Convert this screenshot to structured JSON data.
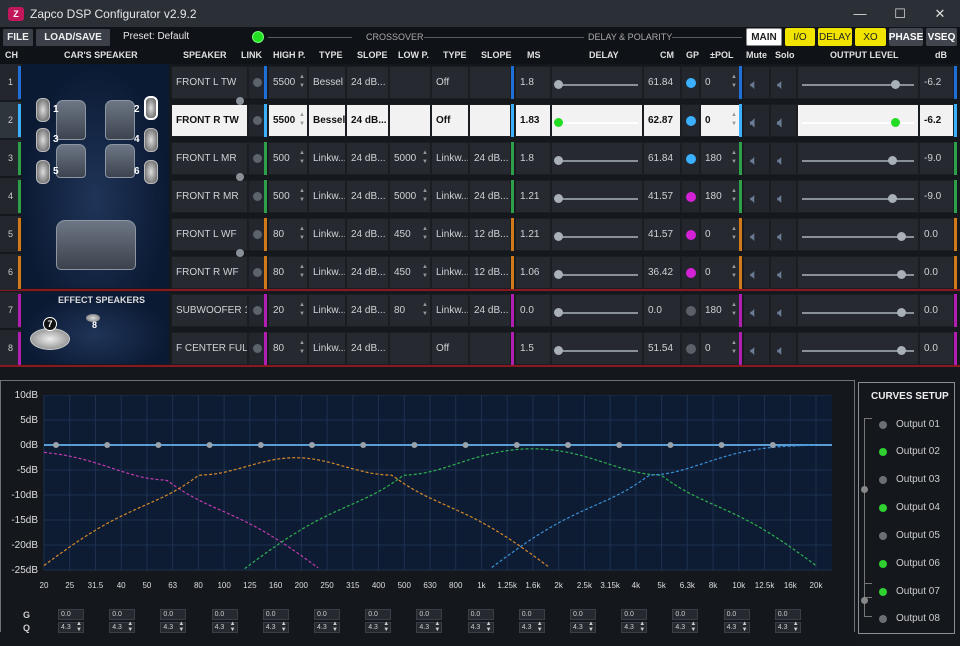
{
  "window": {
    "title": "Zapco DSP Configurator v2.9.2",
    "minimize": "—",
    "maximize": "☐",
    "close": "✕",
    "logo": "Z"
  },
  "menu": {
    "file": "FILE",
    "loadsave": "LOAD/SAVE",
    "preset": "Preset: Default"
  },
  "sections": {
    "crossover": "CROSSOVER",
    "delay": "DELAY & POLARITY"
  },
  "modes": {
    "main": "MAIN",
    "io": "I/O",
    "delay": "DELAY",
    "xo": "XO",
    "phase": "PHASE",
    "vseq": "VSEQ"
  },
  "colors": {
    "accent_yellow": "#f1e400",
    "green": "#22dd22",
    "blue": "#1e6fd8",
    "light_blue": "#3ab0ff",
    "olive": "#2fa04a",
    "orange": "#d27a1a",
    "magenta": "#b01fb2",
    "red_line": "#8a1820"
  },
  "headers": {
    "ch": "CH",
    "car": "CAR'S SPEAKER",
    "speaker": "SPEAKER",
    "link": "LINK",
    "highp": "HIGH P.",
    "type1": "TYPE",
    "slope1": "SLOPE",
    "lowp": "LOW P.",
    "type2": "TYPE",
    "slope2": "SLOPE",
    "ms": "MS",
    "delay": "DELAY",
    "cm": "CM",
    "gp": "GP",
    "pol": "±POL",
    "mute": "Mute",
    "solo": "Solo",
    "output": "OUTPUT LEVEL",
    "db": "dB"
  },
  "car": {
    "effect_title": "EFFECT SPEAKERS",
    "nums": [
      "1",
      "2",
      "3",
      "4",
      "5",
      "6",
      "7",
      "8"
    ]
  },
  "channels": [
    {
      "ch": "1",
      "speaker": "FRONT L TW",
      "hp": "5500",
      "type1": "Bessel",
      "slope1": "24 dB...",
      "lp": "",
      "type2": "Off",
      "slope2": "",
      "ms": "1.8",
      "delay_frac": 0.0,
      "cm": "61.84",
      "gp": "blue",
      "pol": "0",
      "out_frac": 0.83,
      "db": "-6.2",
      "strip": "blue"
    },
    {
      "ch": "2",
      "speaker": "FRONT R TW",
      "hp": "5500",
      "type1": "Bessel",
      "slope1": "24 dB...",
      "lp": "",
      "type2": "Off",
      "slope2": "",
      "ms": "1.83",
      "delay_frac": 0.0,
      "cm": "62.87",
      "gp": "blue",
      "pol": "0",
      "out_frac": 0.83,
      "db": "-6.2",
      "strip": "light_blue"
    },
    {
      "ch": "3",
      "speaker": "FRONT L MR",
      "hp": "500",
      "type1": "Linkw...",
      "slope1": "24 dB...",
      "lp": "5000",
      "type2": "Linkw...",
      "slope2": "24 dB...",
      "ms": "1.8",
      "delay_frac": 0.0,
      "cm": "61.84",
      "gp": "blue",
      "pol": "180",
      "out_frac": 0.8,
      "db": "-9.0",
      "strip": "olive"
    },
    {
      "ch": "4",
      "speaker": "FRONT R MR",
      "hp": "500",
      "type1": "Linkw...",
      "slope1": "24 dB...",
      "lp": "5000",
      "type2": "Linkw...",
      "slope2": "24 dB...",
      "ms": "1.21",
      "delay_frac": 0.0,
      "cm": "41.57",
      "gp": "magenta",
      "pol": "180",
      "out_frac": 0.8,
      "db": "-9.0",
      "strip": "olive"
    },
    {
      "ch": "5",
      "speaker": "FRONT L WF",
      "hp": "80",
      "type1": "Linkw...",
      "slope1": "24 dB...",
      "lp": "450",
      "type2": "Linkw...",
      "slope2": "12 dB...",
      "ms": "1.21",
      "delay_frac": 0.0,
      "cm": "41.57",
      "gp": "magenta",
      "pol": "0",
      "out_frac": 0.88,
      "db": "0.0",
      "strip": "orange"
    },
    {
      "ch": "6",
      "speaker": "FRONT R WF",
      "hp": "80",
      "type1": "Linkw...",
      "slope1": "24 dB...",
      "lp": "450",
      "type2": "Linkw...",
      "slope2": "12 dB...",
      "ms": "1.06",
      "delay_frac": 0.0,
      "cm": "36.42",
      "gp": "magenta",
      "pol": "0",
      "out_frac": 0.88,
      "db": "0.0",
      "strip": "orange"
    },
    {
      "ch": "7",
      "speaker": "SUBWOOFER 1",
      "hp": "20",
      "type1": "Linkw...",
      "slope1": "24 dB...",
      "lp": "80",
      "type2": "Linkw...",
      "slope2": "24 dB...",
      "ms": "0.0",
      "delay_frac": 0.0,
      "cm": "0.0",
      "gp": "grey",
      "pol": "180",
      "out_frac": 0.88,
      "db": "0.0",
      "strip": "magenta"
    },
    {
      "ch": "8",
      "speaker": "F CENTER FULL",
      "hp": "80",
      "type1": "Linkw...",
      "slope1": "24 dB...",
      "lp": "",
      "type2": "Off",
      "slope2": "",
      "ms": "1.5",
      "delay_frac": 0.0,
      "cm": "51.54",
      "gp": "grey",
      "pol": "0",
      "out_frac": 0.88,
      "db": "0.0",
      "strip": "magenta"
    }
  ],
  "eq": {
    "yticks": [
      "10dB",
      "5dB",
      "0dB",
      "-5dB",
      "-10dB",
      "-15dB",
      "-20dB",
      "-25dB"
    ],
    "xticks": [
      "20",
      "25",
      "31.5",
      "40",
      "50",
      "63",
      "80",
      "100",
      "125",
      "160",
      "200",
      "250",
      "315",
      "400",
      "500",
      "630",
      "800",
      "1k",
      "1.25k",
      "1.6k",
      "2k",
      "2.5k",
      "3.15k",
      "4k",
      "5k",
      "6.3k",
      "8k",
      "10k",
      "12.5k",
      "16k",
      "20k"
    ],
    "g_label": "G",
    "q_label": "Q",
    "bands": [
      {
        "g": "0.0",
        "q": "4.3"
      },
      {
        "g": "0.0",
        "q": "4.3"
      },
      {
        "g": "0.0",
        "q": "4.3"
      },
      {
        "g": "0.0",
        "q": "4.3"
      },
      {
        "g": "0.0",
        "q": "4.3"
      },
      {
        "g": "0.0",
        "q": "4.3"
      },
      {
        "g": "0.0",
        "q": "4.3"
      },
      {
        "g": "0.0",
        "q": "4.3"
      },
      {
        "g": "0.0",
        "q": "4.3"
      },
      {
        "g": "0.0",
        "q": "4.3"
      },
      {
        "g": "0.0",
        "q": "4.3"
      },
      {
        "g": "0.0",
        "q": "4.3"
      },
      {
        "g": "0.0",
        "q": "4.3"
      },
      {
        "g": "0.0",
        "q": "4.3"
      },
      {
        "g": "0.0",
        "q": "4.3"
      }
    ]
  },
  "curves": {
    "title": "CURVES SETUP",
    "outputs": [
      {
        "label": "Output 01",
        "on": false
      },
      {
        "label": "Output 02",
        "on": true
      },
      {
        "label": "Output 03",
        "on": false
      },
      {
        "label": "Output 04",
        "on": true
      },
      {
        "label": "Output 05",
        "on": false
      },
      {
        "label": "Output 06",
        "on": true
      },
      {
        "label": "Output 07",
        "on": true
      },
      {
        "label": "Output 08",
        "on": false
      }
    ]
  }
}
